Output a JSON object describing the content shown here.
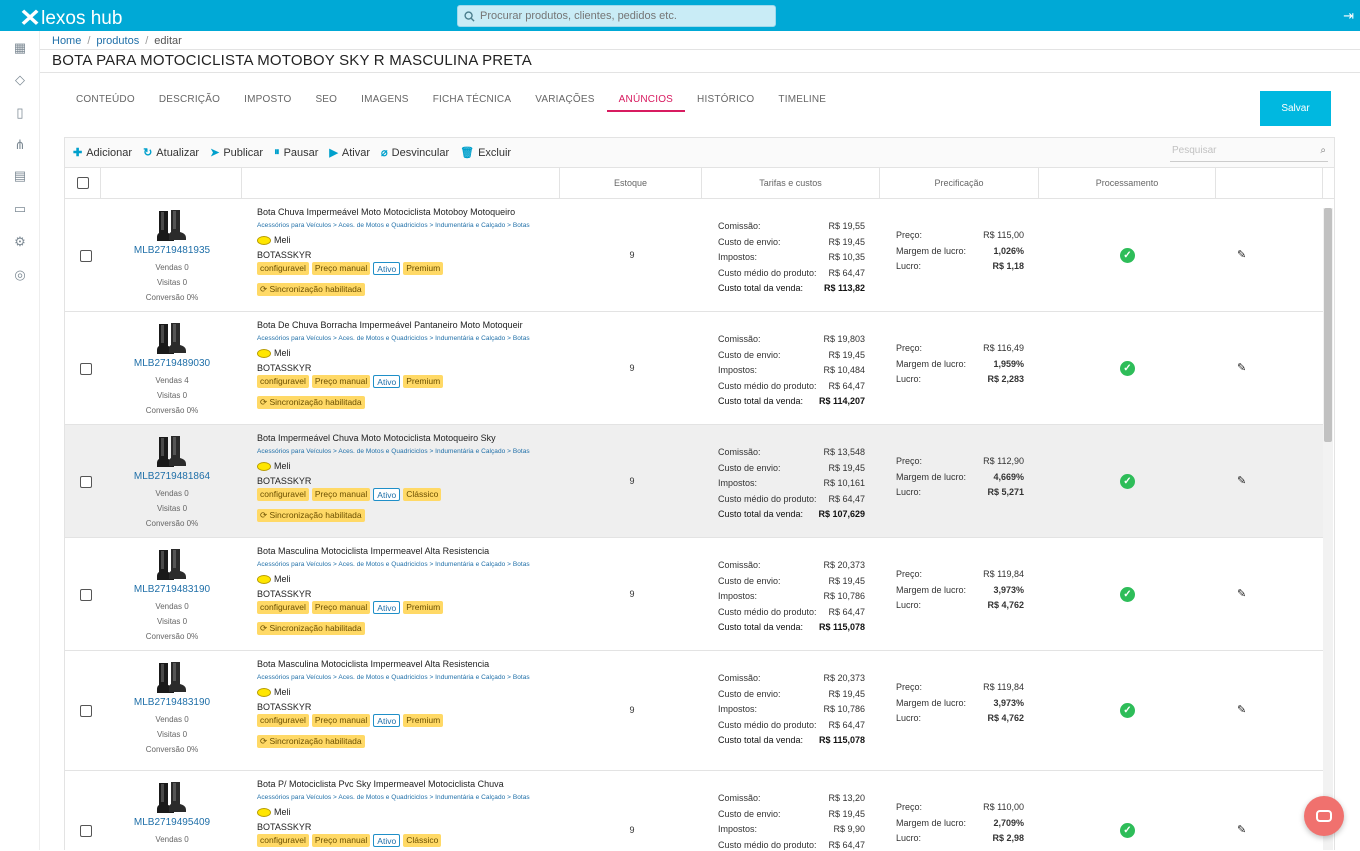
{
  "app": {
    "logo": "lexos hub",
    "search_placeholder": "Procurar produtos, clientes, pedidos etc."
  },
  "breadcrumb": {
    "home": "Home",
    "products": "produtos",
    "current": "editar"
  },
  "page_title": "BOTA PARA MOTOCICLISTA MOTOBOY SKY R MASCULINA PRETA",
  "tabs": [
    "CONTEÚDO",
    "DESCRIÇÃO",
    "IMPOSTO",
    "SEO",
    "IMAGENS",
    "FICHA TÉCNICA",
    "VARIAÇÕES",
    "ANÚNCIOS",
    "HISTÓRICO",
    "TIMELINE"
  ],
  "active_tab": "ANÚNCIOS",
  "save_label": "Salvar",
  "toolbar": {
    "add": "Adicionar",
    "refresh": "Atualizar",
    "publish": "Publicar",
    "pause": "Pausar",
    "activate": "Ativar",
    "unlink": "Desvincular",
    "delete": "Excluir",
    "search_placeholder": "Pesquisar"
  },
  "columns": {
    "stock": "Estoque",
    "fees": "Tarifas e custos",
    "pricing": "Precificação",
    "processing": "Processamento"
  },
  "labels": {
    "sales": "Vendas",
    "visits": "Visitas",
    "conversion": "Conversão",
    "commission": "Comissão:",
    "shipping": "Custo de envio:",
    "taxes": "Impostos:",
    "avg_cost": "Custo médio do produto:",
    "total_cost": "Custo total da venda:",
    "price": "Preço:",
    "margin": "Margem de lucro:",
    "profit": "Lucro:",
    "marketplace": "Meli",
    "sync": "Sincronização habilitada",
    "category": "Acessórios para Veículos > Aces. de Motos e Quadriciclos > Indumentária e Calçado > Botas"
  },
  "listings": [
    {
      "mlb": "MLB2719481935",
      "sales": "Vendas 0",
      "visits": "Visitas 0",
      "conv": "Conversão 0%",
      "title": "Bota Chuva Impermeável Moto Motociclista Motoboy Motoqueiro",
      "sku": "BOTASSKYR",
      "badges": [
        "configuravel",
        "Preço manual",
        "Ativo",
        "Premium"
      ],
      "stock": "9",
      "commission": "R$ 19,55",
      "shipping": "R$ 19,45",
      "taxes": "R$ 10,35",
      "avg_cost": "R$ 64,47",
      "total": "R$ 113,82",
      "price": "R$ 115,00",
      "margin": "1,026%",
      "profit": "R$ 1,18",
      "highlight": false
    },
    {
      "mlb": "MLB2719489030",
      "sales": "Vendas 4",
      "visits": "Visitas 0",
      "conv": "Conversão 0%",
      "title": "Bota De Chuva Borracha Impermeável Pantaneiro Moto Motoqueir",
      "sku": "BOTASSKYR",
      "badges": [
        "configuravel",
        "Preço manual",
        "Ativo",
        "Premium"
      ],
      "stock": "9",
      "commission": "R$ 19,803",
      "shipping": "R$ 19,45",
      "taxes": "R$ 10,484",
      "avg_cost": "R$ 64,47",
      "total": "R$ 114,207",
      "price": "R$ 116,49",
      "margin": "1,959%",
      "profit": "R$ 2,283",
      "highlight": false
    },
    {
      "mlb": "MLB2719481864",
      "sales": "Vendas 0",
      "visits": "Visitas 0",
      "conv": "Conversão 0%",
      "title": "Bota Impermeável Chuva Moto Motociclista Motoqueiro Sky",
      "sku": "BOTASSKYR",
      "badges": [
        "configuravel",
        "Preço manual",
        "Ativo",
        "Clássico"
      ],
      "stock": "9",
      "commission": "R$ 13,548",
      "shipping": "R$ 19,45",
      "taxes": "R$ 10,161",
      "avg_cost": "R$ 64,47",
      "total": "R$ 107,629",
      "price": "R$ 112,90",
      "margin": "4,669%",
      "profit": "R$ 5,271",
      "highlight": true
    },
    {
      "mlb": "MLB2719483190",
      "sales": "Vendas 0",
      "visits": "Visitas 0",
      "conv": "Conversão 0%",
      "title": "Bota Masculina Motociclista Impermeavel Alta Resistencia",
      "sku": "BOTASSKYR",
      "badges": [
        "configuravel",
        "Preço manual",
        "Ativo",
        "Premium"
      ],
      "stock": "9",
      "commission": "R$ 20,373",
      "shipping": "R$ 19,45",
      "taxes": "R$ 10,786",
      "avg_cost": "R$ 64,47",
      "total": "R$ 115,078",
      "price": "R$ 119,84",
      "margin": "3,973%",
      "profit": "R$ 4,762",
      "highlight": false
    },
    {
      "mlb": "MLB2719483190",
      "sales": "Vendas 0",
      "visits": "Visitas 0",
      "conv": "Conversão 0%",
      "title": "Bota Masculina Motociclista Impermeavel Alta Resistencia",
      "sku": "BOTASSKYR",
      "badges": [
        "configuravel",
        "Preço manual",
        "Ativo",
        "Premium"
      ],
      "stock": "9",
      "commission": "R$ 20,373",
      "shipping": "R$ 19,45",
      "taxes": "R$ 10,786",
      "avg_cost": "R$ 64,47",
      "total": "R$ 115,078",
      "price": "R$ 119,84",
      "margin": "3,973%",
      "profit": "R$ 4,762",
      "highlight": false
    },
    {
      "mlb": "MLB2719495409",
      "sales": "Vendas 0",
      "visits": "",
      "conv": "",
      "title": "Bota P/ Motociclista Pvc Sky Impermeavel Motociclista Chuva",
      "sku": "BOTASSKYR",
      "badges": [
        "configuravel",
        "Preço manual",
        "Ativo",
        "Clássico"
      ],
      "stock": "9",
      "commission": "R$ 13,20",
      "shipping": "R$ 19,45",
      "taxes": "R$ 9,90",
      "avg_cost": "R$ 64,47",
      "total": "",
      "price": "R$ 110,00",
      "margin": "2,709%",
      "profit": "R$ 2,98",
      "highlight": false
    }
  ]
}
